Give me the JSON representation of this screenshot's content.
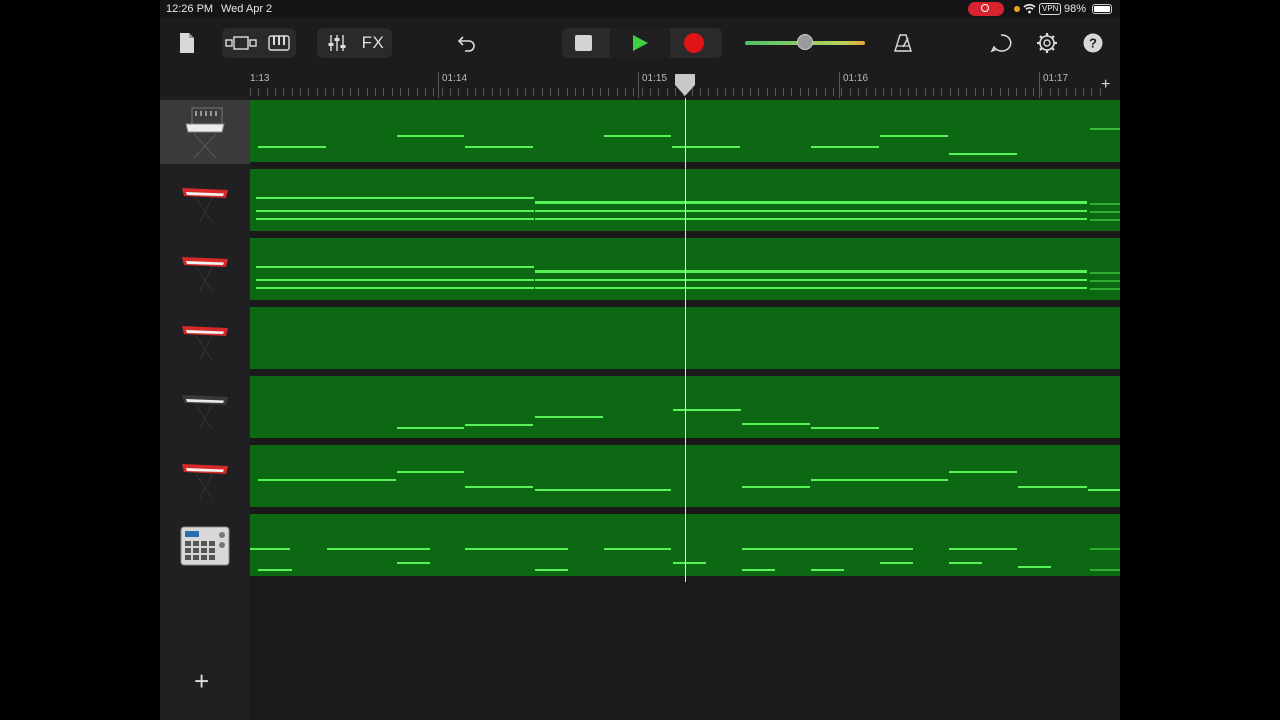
{
  "status_bar": {
    "time": "12:26 PM",
    "date": "Wed Apr 2",
    "vpn": "VPN",
    "battery": "98%"
  },
  "toolbar": {
    "fx_label": "FX",
    "icons": [
      "document-icon",
      "tracks-view-icon",
      "keyboard-icon",
      "mixer-icon",
      "undo-icon",
      "stop-icon",
      "play-icon",
      "record-icon",
      "metronome-icon",
      "loop-browser-icon",
      "settings-icon",
      "help-icon"
    ],
    "master_volume": 0.5,
    "colors": {
      "record": "#e01414",
      "play": "#3fd13f",
      "region": "#0d6813",
      "note": "#56f256"
    }
  },
  "ruler": {
    "labels": [
      "1:13",
      "01:14",
      "01:15",
      "01:16",
      "01:17"
    ]
  },
  "playhead": "01:15.2",
  "tracks": [
    {
      "instrument": "synth-keyboard-icon"
    },
    {
      "instrument": "red-keyboard-icon"
    },
    {
      "instrument": "red-keyboard-icon"
    },
    {
      "instrument": "red-keyboard-icon"
    },
    {
      "instrument": "dark-keyboard-icon"
    },
    {
      "instrument": "red-keyboard-icon"
    },
    {
      "instrument": "drum-machine-icon"
    }
  ]
}
